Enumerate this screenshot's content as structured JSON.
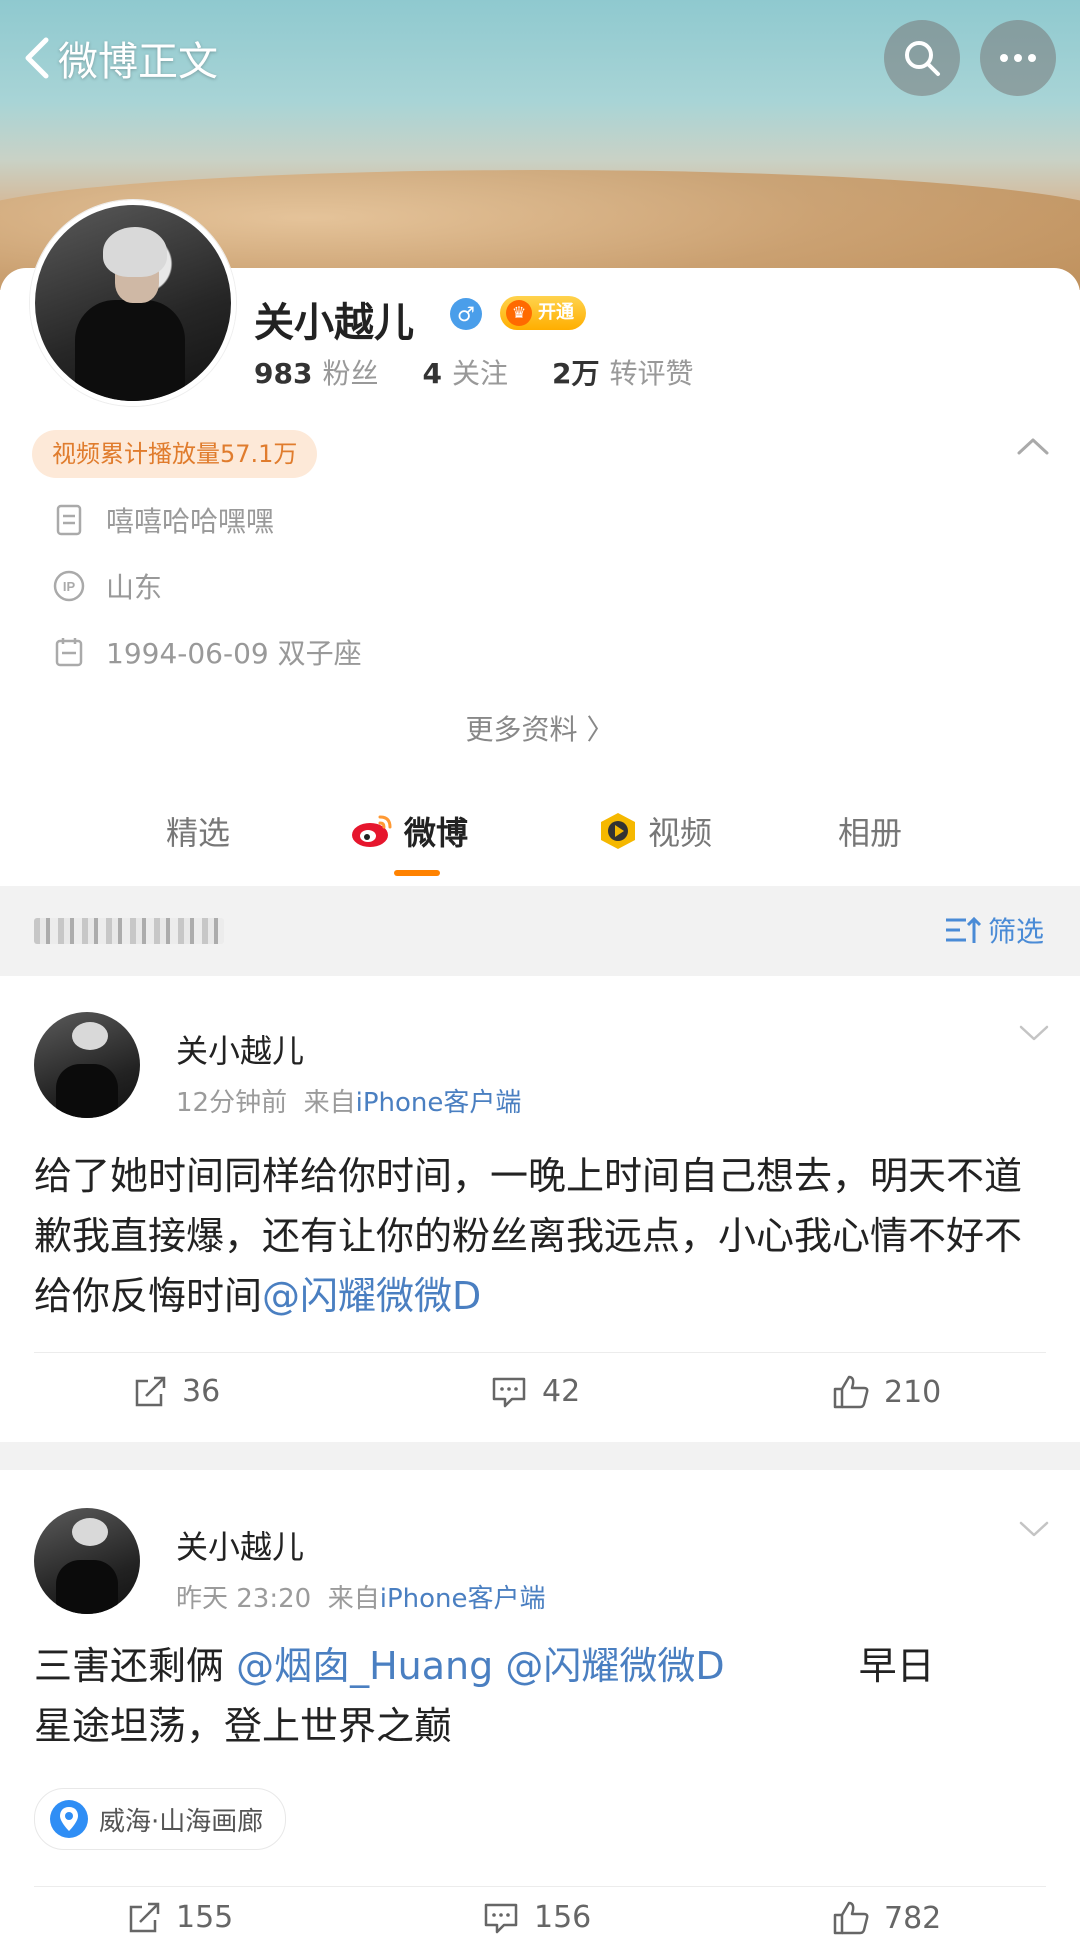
{
  "nav": {
    "back_label": "微博正文",
    "search_icon": "search-icon",
    "more_icon": "more-icon"
  },
  "profile": {
    "name": "关小越儿",
    "vip_label": "开通",
    "followers_count": "983",
    "followers_label": "粉丝",
    "following_count": "4",
    "following_label": "关注",
    "interactions_count": "2万",
    "interactions_label": "转评赞",
    "video_plays": "视频累计播放量57.1万",
    "bio": "嘻嘻哈哈嘿嘿",
    "ip_location": "山东",
    "birthday": "1994-06-09 双子座",
    "more_info": "更多资料 〉"
  },
  "tabs": [
    {
      "label": "精选"
    },
    {
      "label": "微博"
    },
    {
      "label": "视频"
    },
    {
      "label": "相册"
    }
  ],
  "filter": {
    "label": "筛选"
  },
  "posts": [
    {
      "author": "关小越儿",
      "time": "12分钟前",
      "source_prefix": "来自",
      "source": "iPhone客户端",
      "text_before": "给了她时间同样给你时间，一晚上时间自己想去，明天不道歉我直接爆，还有让你的粉丝离我远点，小心我心情不好不给你反悔时间",
      "mentions": [
        "@闪耀微微D"
      ],
      "reposts": "36",
      "comments": "42",
      "likes": "210"
    },
    {
      "author": "关小越儿",
      "time": "昨天 23:20",
      "source_prefix": "来自",
      "source": "iPhone客户端",
      "text_start": "三害还剩俩",
      "mentions": [
        "@烟囱_Huang",
        "@闪耀微微D"
      ],
      "text_end_a": "早日",
      "text_end_b": "星途坦荡，登上世界之巅",
      "location": "威海·山海画廊",
      "reposts": "155",
      "comments": "156",
      "likes": "782"
    }
  ],
  "colors": {
    "accent": "#ff8200",
    "link": "#4a7fc1",
    "video_badge_bg": "#fde9d8",
    "video_badge_text": "#e07c2d"
  }
}
